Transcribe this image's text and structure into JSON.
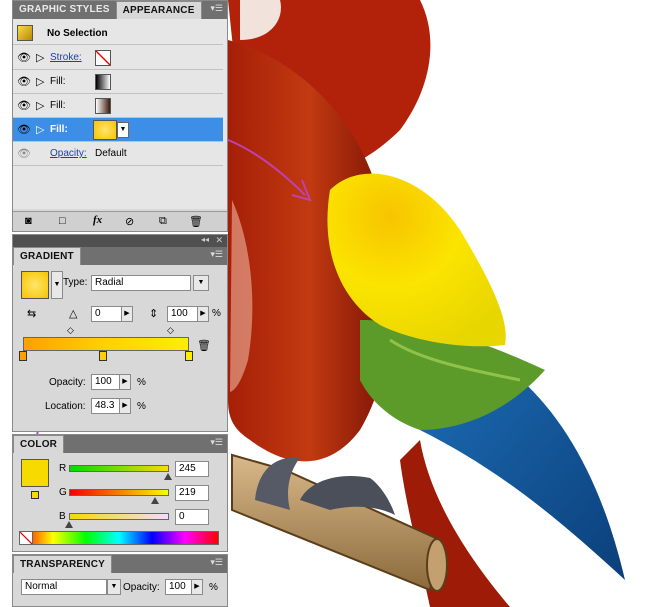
{
  "tabs": {
    "graphic_styles": "GRAPHIC STYLES",
    "appearance": "APPEARANCE"
  },
  "appearance": {
    "header": "No Selection",
    "stroke_label": "Stroke:",
    "fill1_label": "Fill:",
    "fill2_label": "Fill:",
    "fill3_label": "Fill:",
    "opacity_label": "Opacity:",
    "opacity_value": "Default",
    "footer_fx": "fx"
  },
  "gradient": {
    "title": "GRADIENT",
    "type_label": "Type:",
    "type_value": "Radial",
    "angle_value": "0",
    "aspect_value": "100",
    "aspect_unit": "%",
    "opacity_label": "Opacity:",
    "opacity_value": "100",
    "opacity_unit": "%",
    "location_label": "Location:",
    "location_value": "48.3",
    "location_unit": "%"
  },
  "color": {
    "title": "COLOR",
    "r_label": "R",
    "g_label": "G",
    "b_label": "B",
    "r_value": "245",
    "g_value": "219",
    "b_value": "0",
    "swatch": "#f5db00"
  },
  "transparency": {
    "title": "TRANSPARENCY",
    "mode": "Normal",
    "opacity_label": "Opacity:",
    "opacity_value": "100",
    "opacity_unit": "%"
  },
  "colors": {
    "selected_row": "#3d8ee6",
    "panel_header": "#707070",
    "annotation": "#c040b0"
  }
}
